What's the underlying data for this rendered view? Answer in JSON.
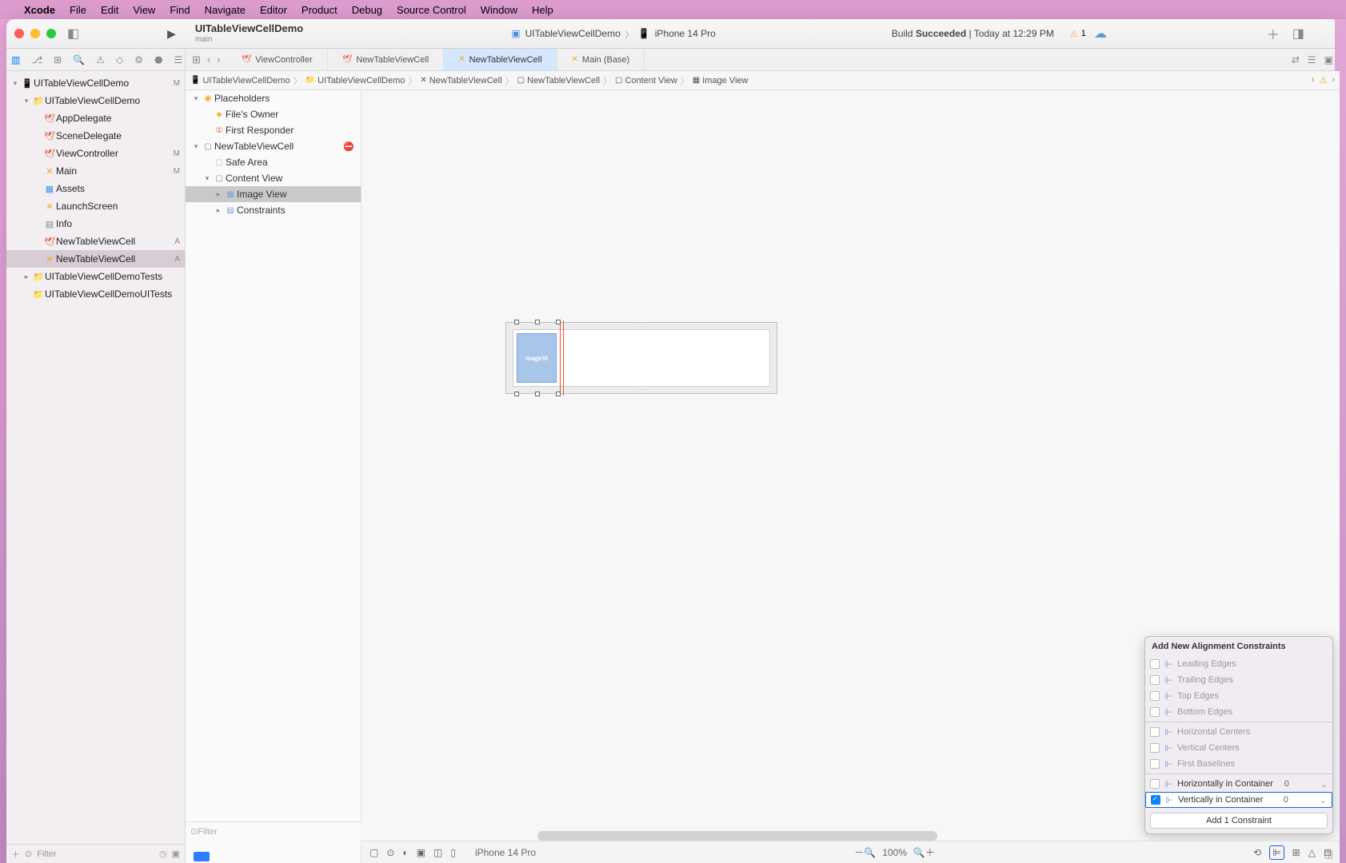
{
  "menubar": {
    "appName": "Xcode",
    "items": [
      "File",
      "Edit",
      "View",
      "Find",
      "Navigate",
      "Editor",
      "Product",
      "Debug",
      "Source Control",
      "Window",
      "Help"
    ]
  },
  "titlebar": {
    "project": "UITableViewCellDemo",
    "branch": "main",
    "scheme": "UITableViewCellDemo",
    "device": "iPhone 14 Pro",
    "status_prefix": "Build",
    "status_word": "Succeeded",
    "status_time": "Today at 12:29 PM",
    "issue_count": "1"
  },
  "tabs": [
    {
      "label": "ViewController",
      "icon": "swift",
      "active": false
    },
    {
      "label": "NewTableViewCell",
      "icon": "swift",
      "active": false
    },
    {
      "label": "NewTableViewCell",
      "icon": "xib",
      "active": true
    },
    {
      "label": "Main (Base)",
      "icon": "xib",
      "active": false
    }
  ],
  "navigator": {
    "items": [
      {
        "indent": 0,
        "disc": "▾",
        "icon": "📱",
        "iconColor": "#4a90e2",
        "label": "UITableViewCellDemo",
        "badge": "M"
      },
      {
        "indent": 1,
        "disc": "▾",
        "icon": "📁",
        "iconColor": "#999",
        "label": "UITableViewCellDemo",
        "badge": ""
      },
      {
        "indent": 2,
        "disc": "",
        "icon": "🕊",
        "iconColor": "#f05138",
        "label": "AppDelegate",
        "badge": ""
      },
      {
        "indent": 2,
        "disc": "",
        "icon": "🕊",
        "iconColor": "#f05138",
        "label": "SceneDelegate",
        "badge": ""
      },
      {
        "indent": 2,
        "disc": "",
        "icon": "🕊",
        "iconColor": "#f05138",
        "label": "ViewController",
        "badge": "M"
      },
      {
        "indent": 2,
        "disc": "",
        "icon": "✕",
        "iconColor": "#f5a623",
        "label": "Main",
        "badge": "M"
      },
      {
        "indent": 2,
        "disc": "",
        "icon": "▦",
        "iconColor": "#4a90e2",
        "label": "Assets",
        "badge": ""
      },
      {
        "indent": 2,
        "disc": "",
        "icon": "✕",
        "iconColor": "#f5a623",
        "label": "LaunchScreen",
        "badge": ""
      },
      {
        "indent": 2,
        "disc": "",
        "icon": "▤",
        "iconColor": "#888",
        "label": "Info",
        "badge": ""
      },
      {
        "indent": 2,
        "disc": "",
        "icon": "🕊",
        "iconColor": "#f05138",
        "label": "NewTableViewCell",
        "badge": "A"
      },
      {
        "indent": 2,
        "disc": "",
        "icon": "✕",
        "iconColor": "#f5a623",
        "label": "NewTableViewCell",
        "badge": "A",
        "selected": true
      },
      {
        "indent": 1,
        "disc": "▸",
        "icon": "📁",
        "iconColor": "#999",
        "label": "UITableViewCellDemoTests",
        "badge": ""
      },
      {
        "indent": 1,
        "disc": "",
        "icon": "📁",
        "iconColor": "#999",
        "label": "UITableViewCellDemoUITests",
        "badge": ""
      }
    ],
    "filterPlaceholder": "Filter"
  },
  "breadcrumb": {
    "items": [
      {
        "icon": "📱",
        "label": "UITableViewCellDemo"
      },
      {
        "icon": "📁",
        "label": "UITableViewCellDemo"
      },
      {
        "icon": "✕",
        "label": "NewTableViewCell"
      },
      {
        "icon": "▢",
        "label": "NewTableViewCell"
      },
      {
        "icon": "▢",
        "label": "Content View"
      },
      {
        "icon": "▦",
        "label": "Image View"
      }
    ]
  },
  "outline": {
    "items": [
      {
        "indent": 0,
        "disc": "▾",
        "icon": "◉",
        "iconColor": "#f5a623",
        "label": "Placeholders"
      },
      {
        "indent": 1,
        "disc": "",
        "icon": "◈",
        "iconColor": "#f5a623",
        "label": "File's Owner"
      },
      {
        "indent": 1,
        "disc": "",
        "icon": "①",
        "iconColor": "#f05138",
        "label": "First Responder"
      },
      {
        "indent": 0,
        "disc": "▾",
        "icon": "▢",
        "iconColor": "#888",
        "label": "NewTableViewCell",
        "error": true
      },
      {
        "indent": 1,
        "disc": "",
        "icon": "▢",
        "iconColor": "#bbb",
        "label": "Safe Area"
      },
      {
        "indent": 1,
        "disc": "▾",
        "icon": "▢",
        "iconColor": "#888",
        "label": "Content View"
      },
      {
        "indent": 2,
        "disc": "▸",
        "icon": "▦",
        "iconColor": "#7aa3d8",
        "label": "Image View",
        "selected": true
      },
      {
        "indent": 2,
        "disc": "▸",
        "icon": "▤",
        "iconColor": "#7aa3d8",
        "label": "Constraints"
      }
    ],
    "filterPlaceholder": "Filter"
  },
  "canvas": {
    "imageViewLabel": "mageVi",
    "device": "iPhone 14 Pro",
    "zoom": "100%"
  },
  "popover": {
    "title": "Add New Alignment Constraints",
    "rows": [
      {
        "label": "Leading Edges",
        "enabled": false
      },
      {
        "label": "Trailing Edges",
        "enabled": false
      },
      {
        "label": "Top Edges",
        "enabled": false
      },
      {
        "label": "Bottom Edges",
        "enabled": false
      },
      {
        "divider": true
      },
      {
        "label": "Horizontal Centers",
        "enabled": false
      },
      {
        "label": "Vertical Centers",
        "enabled": false
      },
      {
        "label": "First Baselines",
        "enabled": false
      },
      {
        "divider": true
      },
      {
        "label": "Horizontally in Container",
        "enabled": true,
        "checked": false,
        "value": "0"
      },
      {
        "label": "Vertically in Container",
        "enabled": true,
        "checked": true,
        "value": "0",
        "highlight": true
      }
    ],
    "button": "Add 1 Constraint"
  }
}
